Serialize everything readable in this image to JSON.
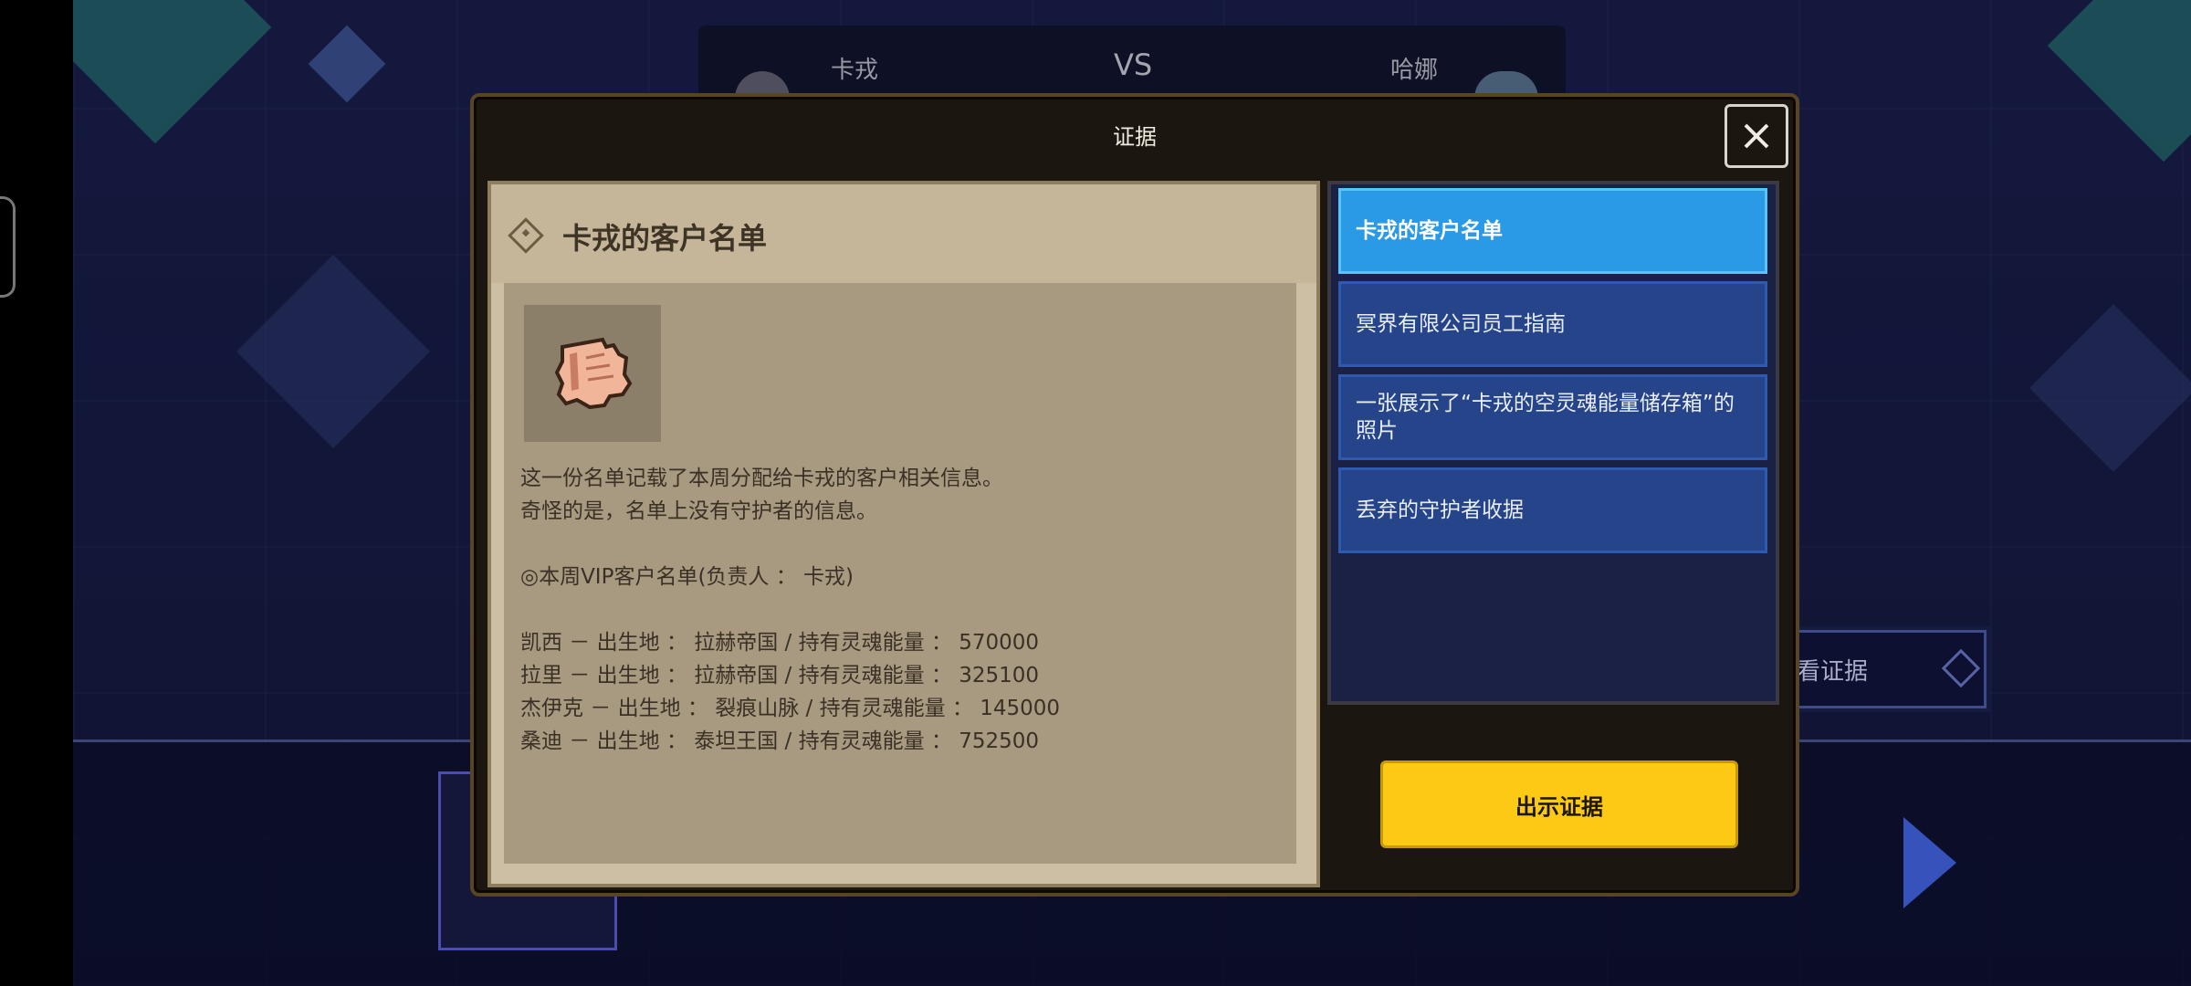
{
  "scene": {
    "vs": {
      "left_name": "卡戎",
      "vs_text": "VS",
      "right_name": "哈娜"
    },
    "view_evidence_label": "看证据"
  },
  "modal": {
    "title": "证据",
    "close_icon": "close-icon",
    "detail": {
      "title": "卡戎的客户名单",
      "item_icon": "scroll-icon",
      "description": "这一份名单记载了本周分配给卡戎的客户相关信息。\n奇怪的是，名单上没有守护者的信息。\n\n◎本周VIP客户名单(负责人 ： 卡戎)\n\n凯西 － 出生地 ： 拉赫帝国 / 持有灵魂能量 ： 570000\n拉里 － 出生地 ： 拉赫帝国 / 持有灵魂能量 ： 325100\n杰伊克 － 出生地 ： 裂痕山脉 / 持有灵魂能量 ： 145000\n桑迪 － 出生地 ： 泰坦王国 / 持有灵魂能量 ： 752500"
    },
    "evidence_list": [
      {
        "label": "卡戎的客户名单",
        "selected": true
      },
      {
        "label": "冥界有限公司员工指南",
        "selected": false
      },
      {
        "label": "一张展示了“卡戎的空灵魂能量储存箱”的照片",
        "selected": false
      },
      {
        "label": "丢弃的守护者收据",
        "selected": false
      }
    ],
    "present_button": "出示证据"
  },
  "colors": {
    "accent_selected": "#2a9ae6",
    "list_item": "#25448a",
    "present_button": "#fcc915",
    "panel_parchment": "#cdbfa4"
  }
}
